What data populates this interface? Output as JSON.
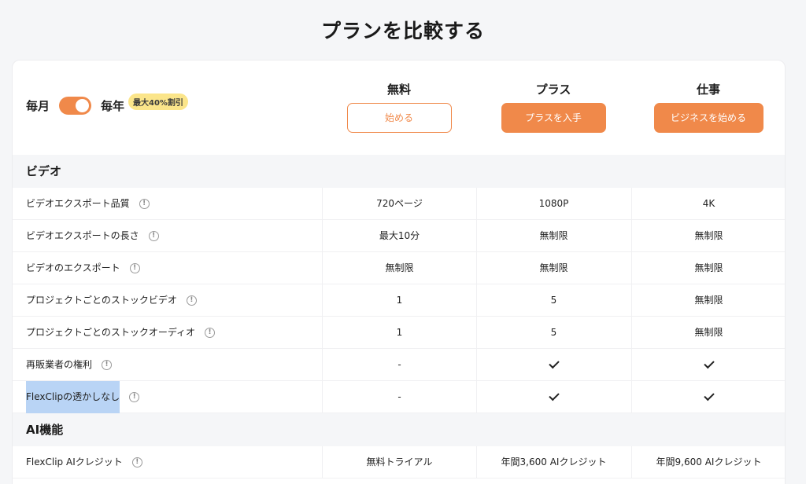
{
  "page_title": "プランを比較する",
  "billing": {
    "monthly": "毎月",
    "yearly": "毎年",
    "discount": "最大40%割引",
    "toggle_on": true
  },
  "plans": [
    {
      "name": "無料",
      "button": "始める",
      "style": "outline"
    },
    {
      "name": "プラス",
      "button": "プラスを入手",
      "style": "solid"
    },
    {
      "name": "仕事",
      "button": "ビジネスを始める",
      "style": "solid"
    }
  ],
  "sections": [
    {
      "title": "ビデオ",
      "rows": [
        {
          "feature": "ビデオエクスポート品質",
          "values": [
            "720ページ",
            "1080P",
            "4K"
          ]
        },
        {
          "feature": "ビデオエクスポートの長さ",
          "values": [
            "最大10分",
            "無制限",
            "無制限"
          ]
        },
        {
          "feature": "ビデオのエクスポート",
          "values": [
            "無制限",
            "無制限",
            "無制限"
          ]
        },
        {
          "feature": "プロジェクトごとのストックビデオ",
          "values": [
            "1",
            "5",
            "無制限"
          ]
        },
        {
          "feature": "プロジェクトごとのストックオーディオ",
          "values": [
            "1",
            "5",
            "無制限"
          ]
        },
        {
          "feature": "再販業者の権利",
          "values": [
            "-",
            "check",
            "check"
          ]
        },
        {
          "feature": "FlexClipの透かしなし",
          "values": [
            "-",
            "check",
            "check"
          ],
          "selected": true
        }
      ]
    },
    {
      "title": "AI機能",
      "rows": [
        {
          "feature": "FlexClip AIクレジット",
          "values": [
            "無料トライアル",
            "年間3,600 AIクレジット",
            "年間9,600 AIクレジット"
          ]
        }
      ]
    }
  ],
  "colors": {
    "accent": "#f0894a",
    "badge": "#fbe58a",
    "section_bg": "#f5f6f8",
    "selection": "#b9d4f5"
  },
  "info_glyph": "!"
}
